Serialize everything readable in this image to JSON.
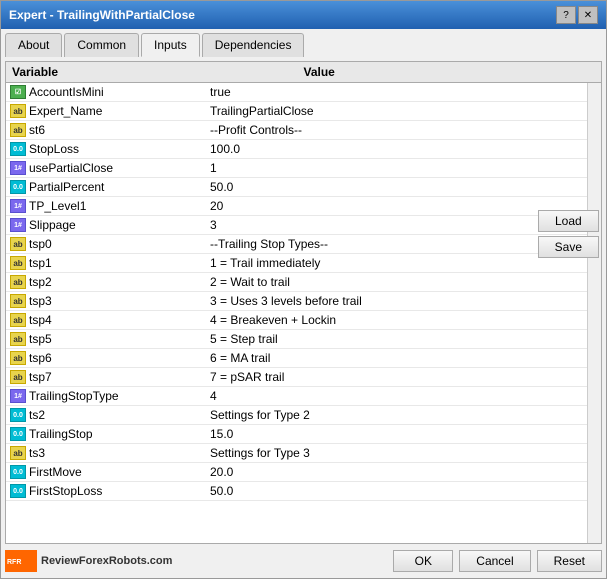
{
  "window": {
    "title": "Expert - TrailingWithPartialClose",
    "help_btn": "?",
    "close_btn": "✕"
  },
  "tabs": [
    {
      "label": "About",
      "active": false
    },
    {
      "label": "Common",
      "active": false
    },
    {
      "label": "Inputs",
      "active": true
    },
    {
      "label": "Dependencies",
      "active": false
    }
  ],
  "table": {
    "col_variable": "Variable",
    "col_value": "Value",
    "rows": [
      {
        "icon": "bool",
        "variable": "AccountIsMini",
        "value": "true"
      },
      {
        "icon": "ab",
        "variable": "Expert_Name",
        "value": "TrailingPartialClose"
      },
      {
        "icon": "ab",
        "variable": "st6",
        "value": "--Profit Controls--"
      },
      {
        "icon": "num",
        "variable": "StopLoss",
        "value": "100.0"
      },
      {
        "icon": "int",
        "variable": "usePartialClose",
        "value": "1"
      },
      {
        "icon": "num",
        "variable": "PartialPercent",
        "value": "50.0"
      },
      {
        "icon": "int",
        "variable": "TP_Level1",
        "value": "20"
      },
      {
        "icon": "int",
        "variable": "Slippage",
        "value": "3"
      },
      {
        "icon": "ab",
        "variable": "tsp0",
        "value": "--Trailing Stop Types--"
      },
      {
        "icon": "ab",
        "variable": "tsp1",
        "value": "1 = Trail immediately"
      },
      {
        "icon": "ab",
        "variable": "tsp2",
        "value": "2 = Wait to trail"
      },
      {
        "icon": "ab",
        "variable": "tsp3",
        "value": "3 = Uses 3 levels before trail"
      },
      {
        "icon": "ab",
        "variable": "tsp4",
        "value": "4 = Breakeven + Lockin"
      },
      {
        "icon": "ab",
        "variable": "tsp5",
        "value": "5 = Step trail"
      },
      {
        "icon": "ab",
        "variable": "tsp6",
        "value": "6 = MA trail"
      },
      {
        "icon": "ab",
        "variable": "tsp7",
        "value": "7 = pSAR trail"
      },
      {
        "icon": "int",
        "variable": "TrailingStopType",
        "value": "4"
      },
      {
        "icon": "num",
        "variable": "ts2",
        "value": "Settings for Type 2"
      },
      {
        "icon": "num",
        "variable": "TrailingStop",
        "value": "15.0"
      },
      {
        "icon": "ab",
        "variable": "ts3",
        "value": "Settings for Type 3"
      },
      {
        "icon": "num",
        "variable": "FirstMove",
        "value": "20.0"
      },
      {
        "icon": "num",
        "variable": "FirstStopLoss",
        "value": "50.0"
      }
    ]
  },
  "side_buttons": {
    "load": "Load",
    "save": "Save"
  },
  "footer": {
    "ok": "OK",
    "cancel": "Cancel",
    "reset": "Reset",
    "watermark": "ReviewForexRobots.com"
  }
}
